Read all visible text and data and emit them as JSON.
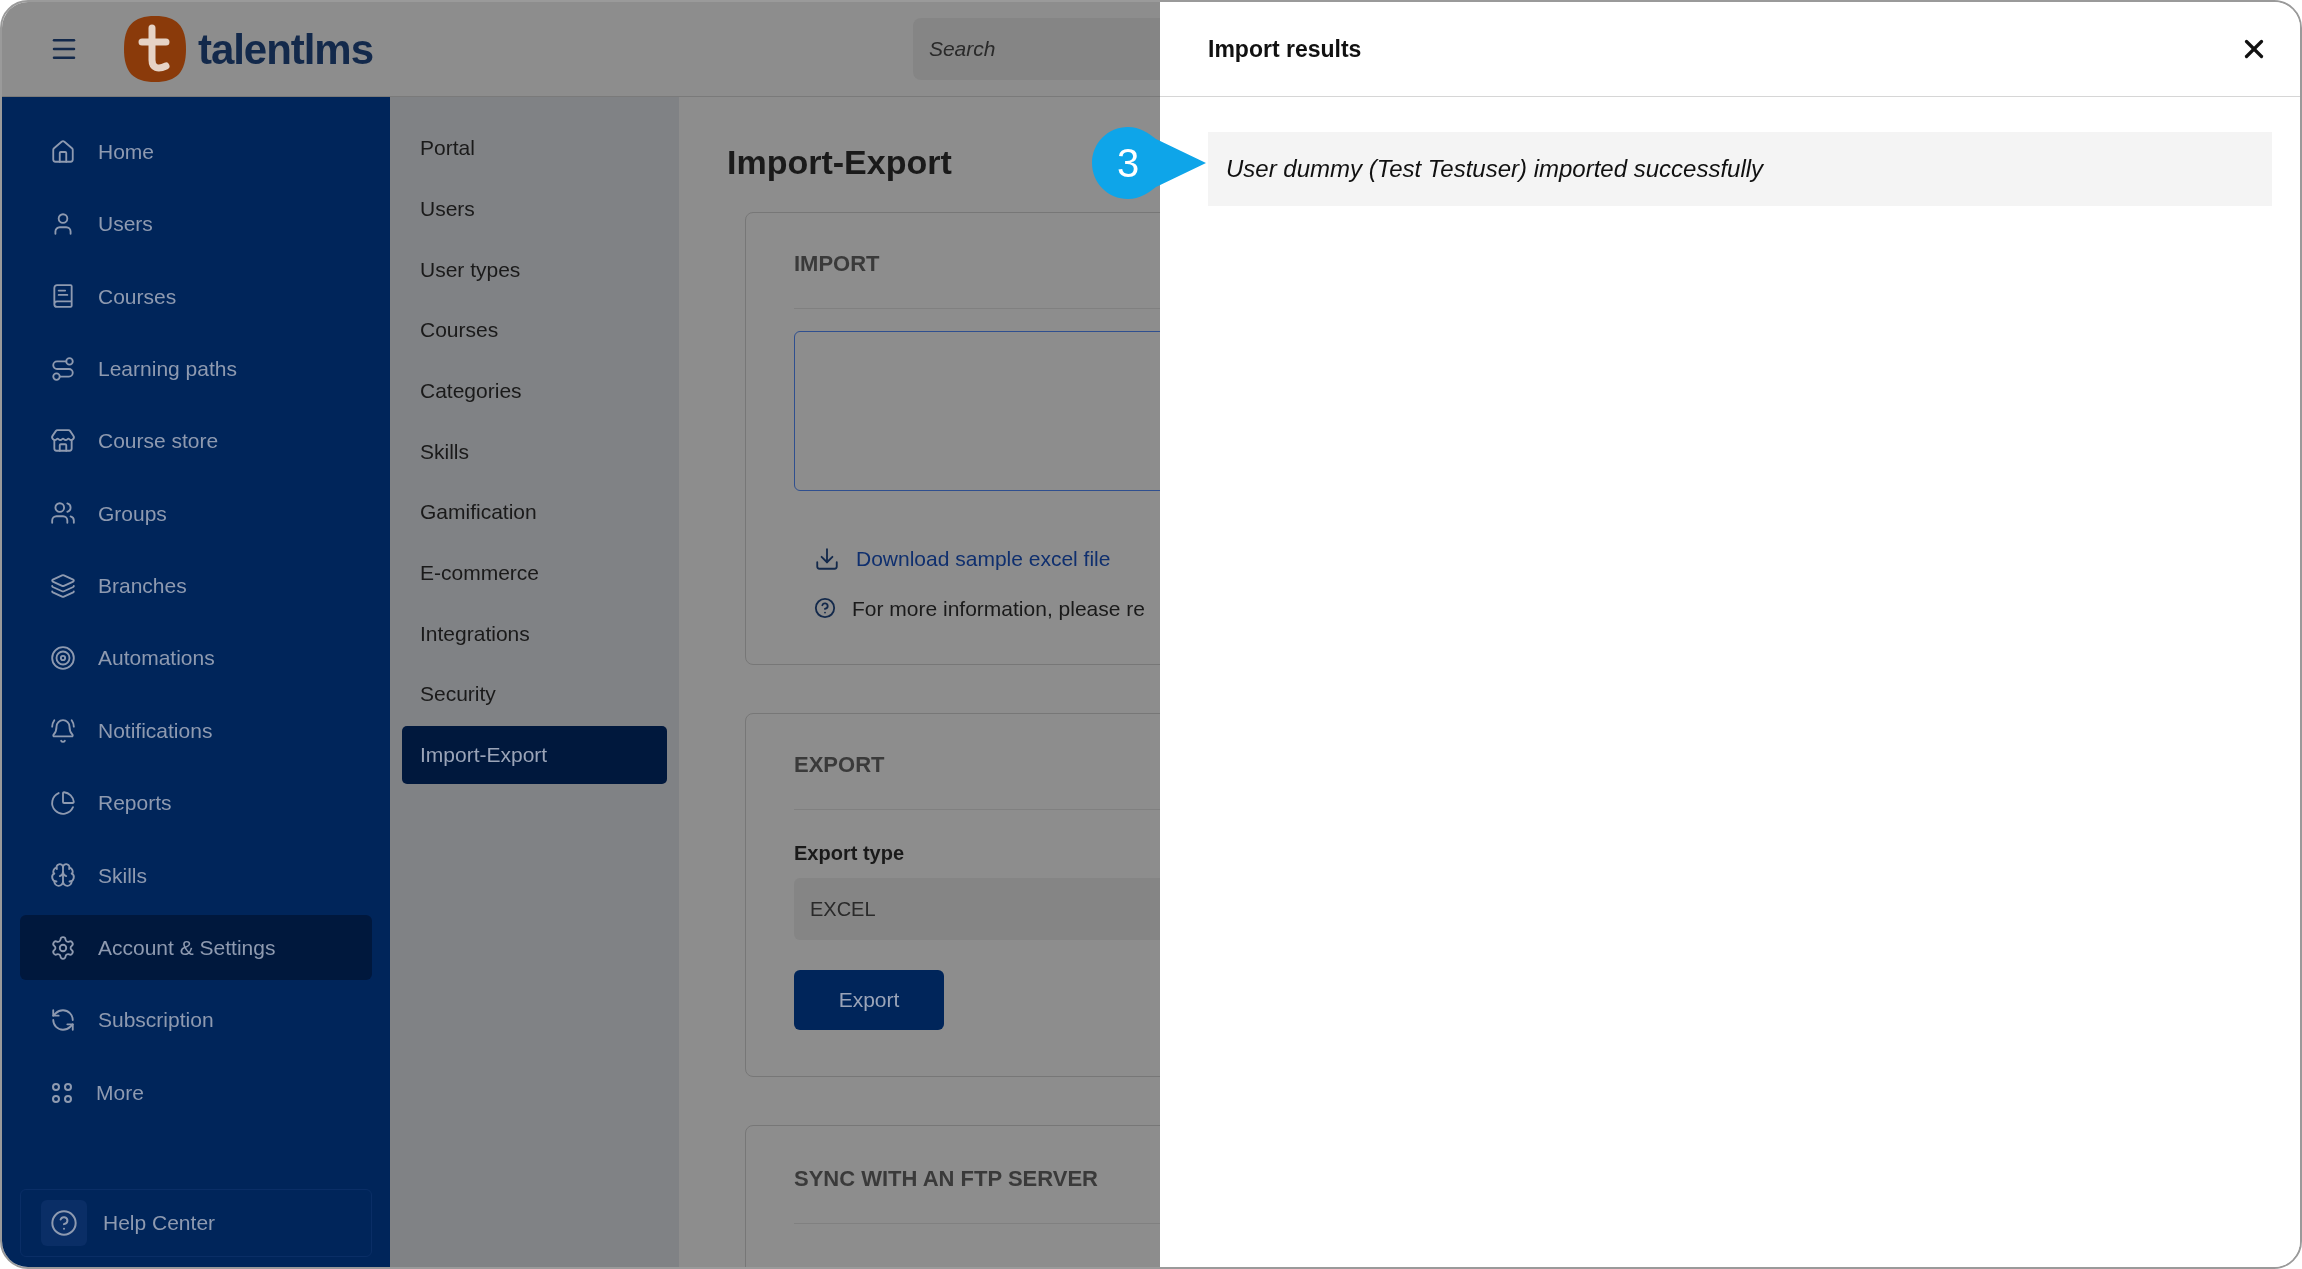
{
  "header": {
    "logo_text": "talentlms",
    "search": {
      "placeholder": "Search"
    }
  },
  "sidebar": {
    "items": [
      {
        "label": "Home",
        "selected": false
      },
      {
        "label": "Users",
        "selected": false
      },
      {
        "label": "Courses",
        "selected": false
      },
      {
        "label": "Learning paths",
        "selected": false
      },
      {
        "label": "Course store",
        "selected": false
      },
      {
        "label": "Groups",
        "selected": false
      },
      {
        "label": "Branches",
        "selected": false
      },
      {
        "label": "Automations",
        "selected": false
      },
      {
        "label": "Notifications",
        "selected": false
      },
      {
        "label": "Reports",
        "selected": false
      },
      {
        "label": "Skills",
        "selected": false
      },
      {
        "label": "Account & Settings",
        "selected": true
      },
      {
        "label": "Subscription",
        "selected": false
      },
      {
        "label": "More",
        "selected": false
      }
    ],
    "help": "Help Center"
  },
  "submenu": {
    "items": [
      {
        "label": "Portal",
        "selected": false
      },
      {
        "label": "Users",
        "selected": false
      },
      {
        "label": "User types",
        "selected": false
      },
      {
        "label": "Courses",
        "selected": false
      },
      {
        "label": "Categories",
        "selected": false
      },
      {
        "label": "Skills",
        "selected": false
      },
      {
        "label": "Gamification",
        "selected": false
      },
      {
        "label": "E-commerce",
        "selected": false
      },
      {
        "label": "Integrations",
        "selected": false
      },
      {
        "label": "Security",
        "selected": false
      },
      {
        "label": "Import-Export",
        "selected": true
      }
    ]
  },
  "page": {
    "title": "Import-Export",
    "import": {
      "heading": "IMPORT",
      "download_link": "Download sample excel file",
      "info": "For more information, please re"
    },
    "export": {
      "heading": "EXPORT",
      "type_label": "Export type",
      "type_value": "EXCEL",
      "button": "Export"
    },
    "sync": {
      "heading": "SYNC WITH AN FTP SERVER"
    }
  },
  "panel": {
    "title": "Import results",
    "results": [
      "User dummy (Test Testuser) imported successfully"
    ],
    "callout": "3"
  }
}
